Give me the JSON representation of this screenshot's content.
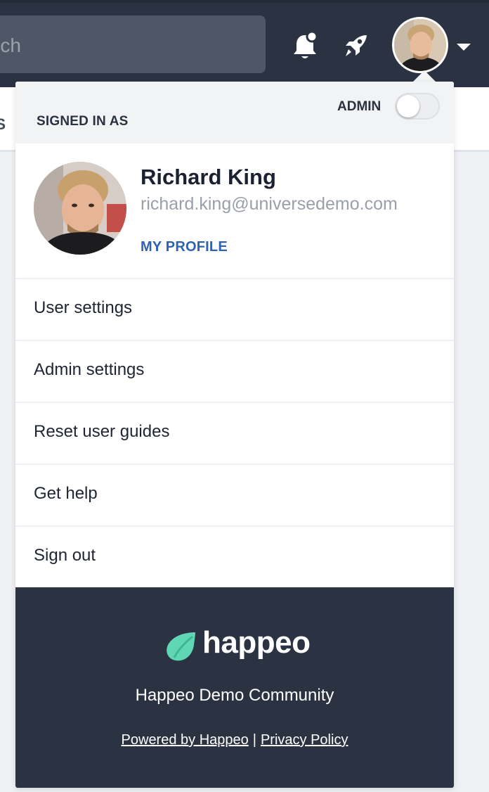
{
  "topbar": {
    "search_partial": "ch",
    "icons": [
      "notification-bell-icon",
      "rocket-icon",
      "chevron-down-icon"
    ]
  },
  "page_behind": {
    "tab_fragment": "S"
  },
  "dropdown": {
    "signed_in_label": "SIGNED IN AS",
    "admin_label": "ADMIN",
    "admin_toggle_on": false,
    "user": {
      "name": "Richard King",
      "email": "richard.king@universedemo.com",
      "profile_link": "MY PROFILE"
    },
    "menu": [
      {
        "label": "User settings"
      },
      {
        "label": "Admin settings"
      },
      {
        "label": "Reset user guides"
      },
      {
        "label": "Get help"
      },
      {
        "label": "Sign out"
      }
    ],
    "footer": {
      "brand": "happeo",
      "community": "Happeo Demo Community",
      "powered_by": "Powered by Happeo",
      "separator": "|",
      "privacy": "Privacy Policy"
    }
  },
  "colors": {
    "navbar": "#2b3343",
    "link_blue": "#2d63b0",
    "brand_green": "#5fd6b4"
  }
}
